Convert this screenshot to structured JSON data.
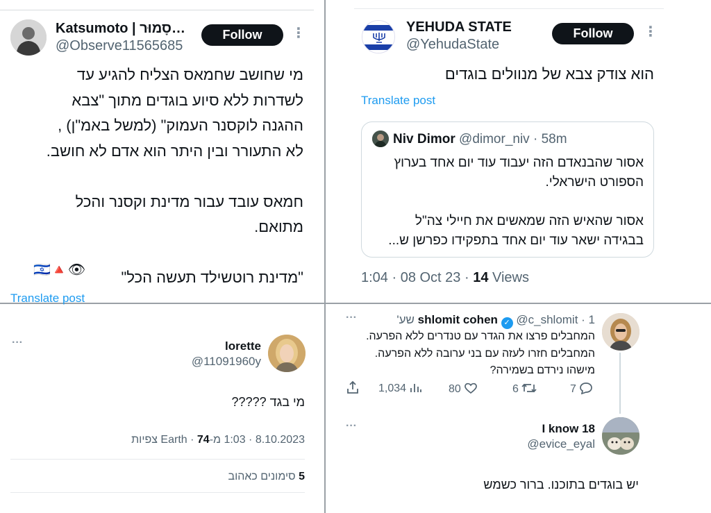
{
  "panel_top_left": {
    "name": "Katsumoto | סָמוּר…",
    "handle": "@Observe11565685",
    "follow_label": "Follow",
    "text": "מי שחושב שחמאס הצליח להגיע עד\nלשדרות ללא סיוע בוגדים מתוך \"צבא\nההגנה לוקסנר העמוק\" (למשל באמ\"ן) ,\nלא התעורר ובין היתר הוא אדם לא חושב.\n\nחמאס עובד עבור מדינת וקסנר והכל\nמתואם.\n\n\"מדינת רוטשילד תעשה הכל\"",
    "emoji": "🇮🇱🔺👁",
    "translate_label": "Translate post"
  },
  "panel_top_right": {
    "name": "YEHUDA STATE",
    "handle": "@YehudaState",
    "follow_label": "Follow",
    "text": "הוא צודק צבא של מנוולים בוגדים",
    "translate_label": "Translate post",
    "quote": {
      "name": "Niv Dimor",
      "handle": "@dimor_niv",
      "time": "· 58m",
      "text": "אסור שהבנאדם הזה יעבוד עוד יום אחד בערוץ\nהספורט הישראלי.\n\nאסור שהאיש הזה שמאשים את חיילי צה\"ל\nבבגידה ישאר עוד יום אחד בתפקידו כפרשן ש..."
    },
    "meta": "1:04 · 08 Oct 23 · ",
    "views_count": "14",
    "views_label": " Views"
  },
  "panel_bottom_left": {
    "name": "lorette",
    "handle": "@11091960y",
    "text": "מי בגד ?????",
    "meta_text": "8.10.2023 · 1:03 מ-Earth · ",
    "views_count": "74",
    "views_label": " צפיות",
    "likes_count": "5",
    "likes_label": " סימונים כאהוב"
  },
  "panel_bottom_right": {
    "reply1": {
      "name": "shlomit cohen",
      "handle_time": "@c_shlomit · 1 שע'",
      "text": "המחבלים פרצו את הגדר עם טנדרים ללא הפרעה.\nהמחבלים חזרו לעזה עם בני ערובה ללא הפרעה.\nמישהו נירדם בשמירה?",
      "stats": {
        "views": "1,034",
        "likes": "80",
        "retweets": "6",
        "replies": "7"
      }
    },
    "reply2": {
      "name": "I know 18",
      "handle": "@evice_eyal",
      "text": "יש בוגדים בתוכנו. ברור כשמש"
    },
    "verified_color": "#1d9bf0"
  }
}
